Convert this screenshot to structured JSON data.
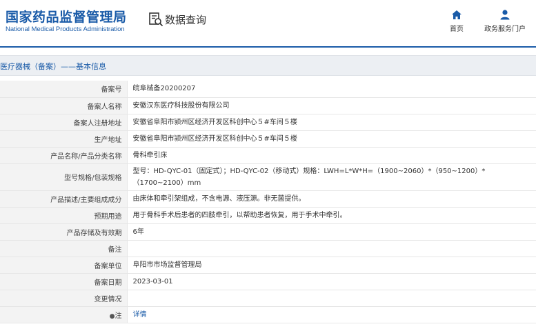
{
  "header": {
    "logo_cn": "国家药品监督管理局",
    "logo_en": "National Medical Products Administration",
    "search_title": "数据查询",
    "nav": [
      {
        "label": "首页",
        "icon": "home-icon"
      },
      {
        "label": "政务服务门户",
        "icon": "user-icon"
      }
    ]
  },
  "section": {
    "title": "医疗器械（备案）——基本信息"
  },
  "rows": [
    {
      "key": "备案号",
      "value": "皖阜械备20200207"
    },
    {
      "key": "备案人名称",
      "value": "安徽汉东医疗科技股份有限公司"
    },
    {
      "key": "备案人注册地址",
      "value": "安徽省阜阳市颍州区经济开发区科创中心５#车间５楼"
    },
    {
      "key": "生产地址",
      "value": "安徽省阜阳市颍州区经济开发区科创中心５#车间５楼"
    },
    {
      "key": "产品名称/产品分类名称",
      "value": "骨科牵引床"
    },
    {
      "key": "型号规格/包装规格",
      "value": "型号：HD-QYC-01（固定式）；HD-QYC-02（移动式）规格：LWH=L*W*H=（1900~2060）*（950~1200）*（1700~2100）mm"
    },
    {
      "key": "产品描述/主要组成成分",
      "value": "由床体和牵引架组成，不含电源、液压源。非无菌提供。"
    },
    {
      "key": "预期用途",
      "value": "用于骨科手术后患者的四肢牵引，以帮助患者恢复，用于手术中牵引。"
    },
    {
      "key": "产品存储及有效期",
      "value": "6年"
    },
    {
      "key": "备注",
      "value": ""
    },
    {
      "key": "备案单位",
      "value": "阜阳市市场监督管理局"
    },
    {
      "key": "备案日期",
      "value": "2023-03-01"
    },
    {
      "key": "变更情况",
      "value": ""
    },
    {
      "key": "注",
      "value": "详情"
    }
  ],
  "colors": {
    "brand_blue": "#1a5ba8",
    "key_bg": "#f3f3f3",
    "section_bg": "#eceff3"
  }
}
